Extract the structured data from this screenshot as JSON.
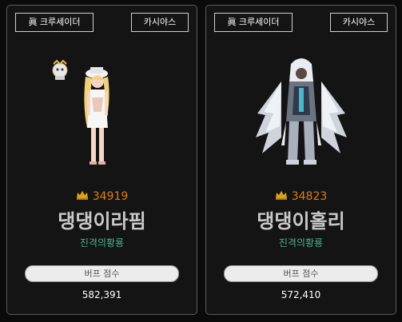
{
  "cards": [
    {
      "job_tag": "眞 크루세이더",
      "server_tag": "카시야스",
      "fame": "34919",
      "name": "댕댕이라핌",
      "guild": "진격의황룡",
      "buff_label": "버프 점수",
      "buff_value": "582,391",
      "avatar_icon": "female-crusader-character-sprite"
    },
    {
      "job_tag": "眞 크루세이더",
      "server_tag": "카시야스",
      "fame": "34823",
      "name": "댕댕이홀리",
      "guild": "진격의황룡",
      "buff_label": "버프 점수",
      "buff_value": "572,410",
      "avatar_icon": "male-crusader-character-sprite"
    }
  ],
  "colors": {
    "background": "#0b0b0b",
    "card": "#141414",
    "card_border": "#5a5a5a",
    "fame": "#e07b14",
    "name": "#c9c9c9",
    "guild": "#4caf8a",
    "button_bg": "#ececec"
  },
  "icons": {
    "fame": "crown-icon"
  }
}
